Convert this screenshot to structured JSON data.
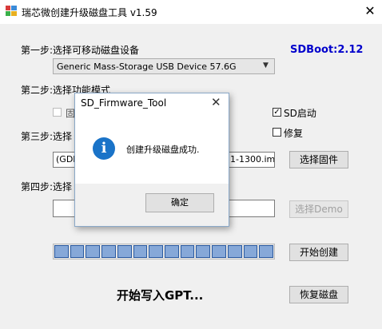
{
  "window": {
    "title": "瑞芯微创建升级磁盘工具 v1.59",
    "close_glyph": "✕"
  },
  "step1": {
    "label": "第一步:选择可移动磁盘设备",
    "device_value": "Generic Mass-Storage USB Device   57.6G",
    "dropdown_glyph": "▼"
  },
  "sdboot": "SDBoot:2.12",
  "step2": {
    "label": "第二步:选择功能模式",
    "option_partial": "固",
    "sd_boot_label": "SD启动",
    "sd_boot_checked": true,
    "repair_label": "修复",
    "repair_checked": false
  },
  "step3": {
    "label": "第三步:选择",
    "firmware_path_left": "(GDK",
    "firmware_path_right": "1-1300.img",
    "select_firmware_button": "选择固件"
  },
  "step4": {
    "label": "第四步:选择",
    "select_demo_button": "选择Demo"
  },
  "progress": {
    "segments": 14,
    "fraction": 1.0
  },
  "start_create_button": "开始创建",
  "restore_disk_button": "恢复磁盘",
  "status": "开始写入GPT...",
  "dialog": {
    "title": "SD_Firmware_Tool",
    "close_glyph": "✕",
    "icon_glyph": "i",
    "message": "创建升级磁盘成功.",
    "ok_button": "确定"
  },
  "colors": {
    "sdboot": "#0000cc",
    "info_icon": "#1a73c8",
    "progress_segment": "#86a8d8"
  }
}
